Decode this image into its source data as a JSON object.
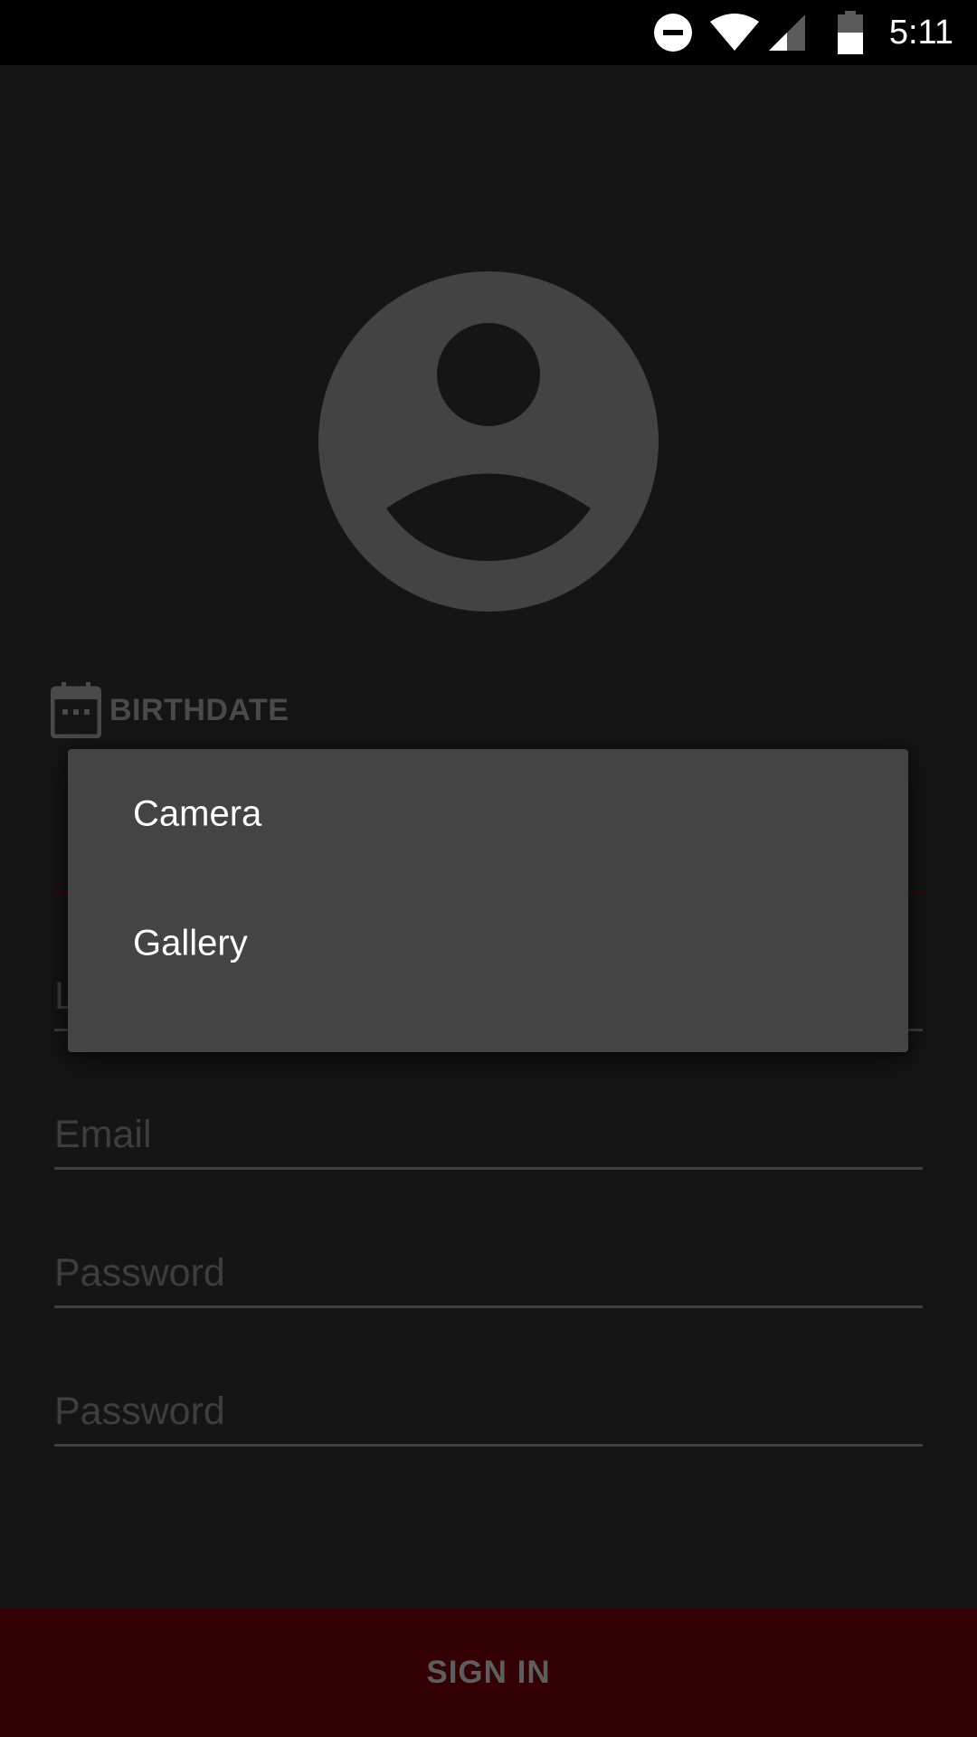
{
  "status_bar": {
    "time": "5:11",
    "icons": [
      "do-not-disturb-icon",
      "wifi-icon",
      "cell-signal-icon",
      "battery-icon"
    ]
  },
  "avatar": {
    "icon": "account-circle-icon"
  },
  "birthdate": {
    "icon": "calendar-icon",
    "label": "BIRTHDATE"
  },
  "form": {
    "first_name_placeholder": "",
    "last_name_placeholder": "L",
    "email_placeholder": "Email",
    "password_placeholder": "Password",
    "confirm_password_placeholder": "Password"
  },
  "dialog": {
    "items": [
      {
        "label": "Camera"
      },
      {
        "label": "Gallery"
      }
    ]
  },
  "signin": {
    "label": "SIGN IN"
  },
  "colors": {
    "background": "#151515",
    "dialog": "#444444",
    "accent_dark_red": "#330004",
    "error_line": "#4a0000"
  }
}
